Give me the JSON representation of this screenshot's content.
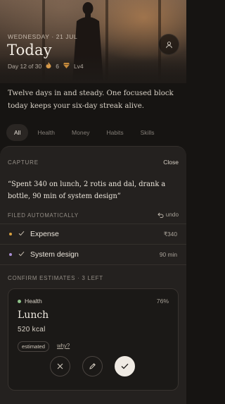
{
  "header": {
    "date": "WEDNESDAY · 21 JUL",
    "title": "Today",
    "day_progress": "Day 12 of 30",
    "streak": "6",
    "level": "Lv4"
  },
  "summary": "Twelve days in and steady. One focused block today keeps your six-day streak alive.",
  "filters": [
    {
      "label": "All",
      "active": true
    },
    {
      "label": "Health"
    },
    {
      "label": "Money"
    },
    {
      "label": "Habits"
    },
    {
      "label": "Skills"
    }
  ],
  "capture": {
    "label": "CAPTURE",
    "close": "Close",
    "quote": "“Spent 340 on lunch, 2 rotis and dal, drank a bottle, 90 min of system design”"
  },
  "filed": {
    "label": "FILED AUTOMATICALLY",
    "undo": "undo",
    "items": [
      {
        "name": "Expense",
        "value": "₹340",
        "color": "#d8a03e"
      },
      {
        "name": "System design",
        "value": "90 min",
        "color": "#a98ed6"
      }
    ]
  },
  "confirm": {
    "label": "CONFIRM ESTIMATES · 3 LEFT",
    "card": {
      "category": "Health",
      "category_color": "#8fc38a",
      "confidence": "76%",
      "name": "Lunch",
      "value": "520 kcal",
      "tag": "estimated",
      "why": "why?"
    }
  },
  "icons": {
    "profile": "user-icon",
    "streak": "flame-icon",
    "level": "diamond-icon",
    "undo": "undo-icon",
    "check": "check-icon",
    "reject": "close-icon",
    "edit": "pencil-icon",
    "accept": "check-icon"
  }
}
